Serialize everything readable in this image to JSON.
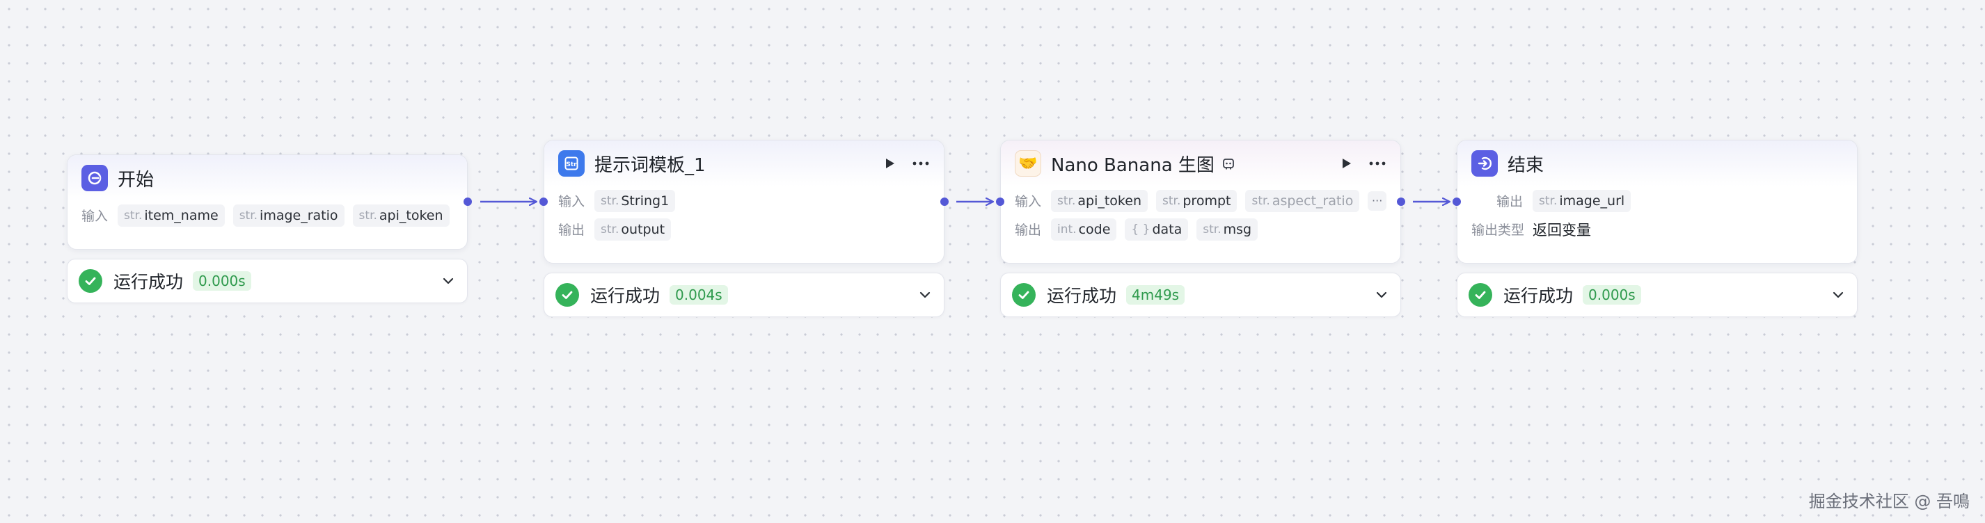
{
  "colors": {
    "accent": "#5458d6",
    "success": "#35b35a",
    "success_badge_bg": "#e3f6e6",
    "success_badge_text": "#2f9a4d"
  },
  "nodes": [
    {
      "id": "start",
      "title": "开始",
      "icon": "start-node-icon",
      "rows": [
        {
          "label": "输入",
          "params": [
            {
              "type": "str.",
              "name": "item_name"
            },
            {
              "type": "str.",
              "name": "image_ratio"
            },
            {
              "type": "str.",
              "name": "api_token"
            }
          ]
        }
      ],
      "status": {
        "text": "运行成功",
        "time": "0.000s"
      }
    },
    {
      "id": "prompt-template",
      "title": "提示词模板_1",
      "icon": "template-node-icon",
      "actions": [
        "play-icon",
        "more-icon"
      ],
      "rows": [
        {
          "label": "输入",
          "params": [
            {
              "type": "str.",
              "name": "String1"
            }
          ]
        },
        {
          "label": "输出",
          "params": [
            {
              "type": "str.",
              "name": "output"
            }
          ]
        }
      ],
      "status": {
        "text": "运行成功",
        "time": "0.004s"
      }
    },
    {
      "id": "nano-banana",
      "title": "Nano Banana 生图",
      "icon": "handshake-icon",
      "title_icon": "plugin-icon",
      "actions": [
        "play-icon",
        "more-icon"
      ],
      "rows": [
        {
          "label": "输入",
          "params": [
            {
              "type": "str.",
              "name": "api_token"
            },
            {
              "type": "str.",
              "name": "prompt"
            },
            {
              "type": "str.",
              "name": "aspect_ratio"
            }
          ],
          "more": "···"
        },
        {
          "label": "输出",
          "params": [
            {
              "type": "int.",
              "name": "code"
            },
            {
              "type": "{ }",
              "name": "data"
            },
            {
              "type": "str.",
              "name": "msg"
            }
          ]
        }
      ],
      "status": {
        "text": "运行成功",
        "time": "4m49s"
      }
    },
    {
      "id": "end",
      "title": "结束",
      "icon": "end-node-icon",
      "rows": [
        {
          "label": "输出",
          "params": [
            {
              "type": "str.",
              "name": "image_url"
            }
          ]
        },
        {
          "label": "输出类型",
          "value": "返回变量"
        }
      ],
      "status": {
        "text": "运行成功",
        "time": "0.000s"
      }
    }
  ],
  "watermark": "掘金技术社区 @ 吾鳴"
}
